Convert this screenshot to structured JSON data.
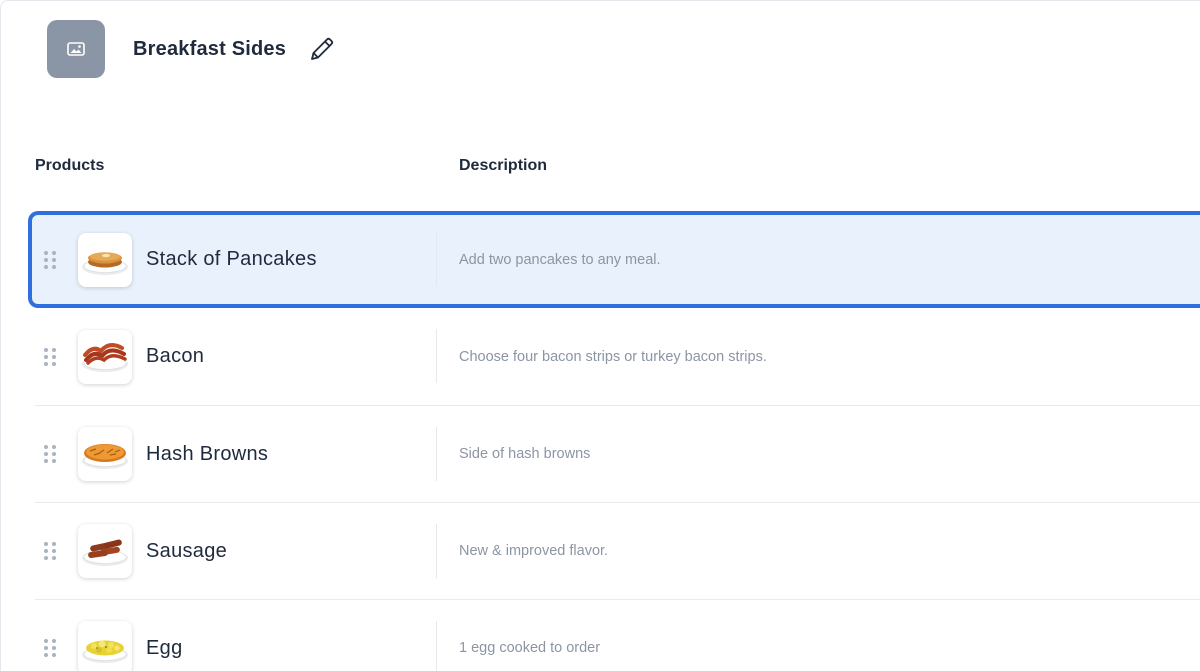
{
  "collection": {
    "title": "Breakfast Sides"
  },
  "columns": {
    "products": "Products",
    "description": "Description"
  },
  "products": [
    {
      "name": "Stack of Pancakes",
      "description": "Add two pancakes to any meal.",
      "image": "pancakes",
      "selected": true
    },
    {
      "name": "Bacon",
      "description": "Choose four bacon strips or turkey bacon strips.",
      "image": "bacon",
      "selected": false
    },
    {
      "name": "Hash Browns",
      "description": "Side of hash browns",
      "image": "hash-browns",
      "selected": false
    },
    {
      "name": "Sausage",
      "description": "New & improved flavor.",
      "image": "sausage",
      "selected": false
    },
    {
      "name": "Egg",
      "description": "1 egg cooked to order",
      "image": "egg",
      "selected": false
    }
  ],
  "colors": {
    "accent": "#2f6fe0",
    "selected_bg": "#e9f1fd",
    "thumb_placeholder": "#8a95a5"
  }
}
